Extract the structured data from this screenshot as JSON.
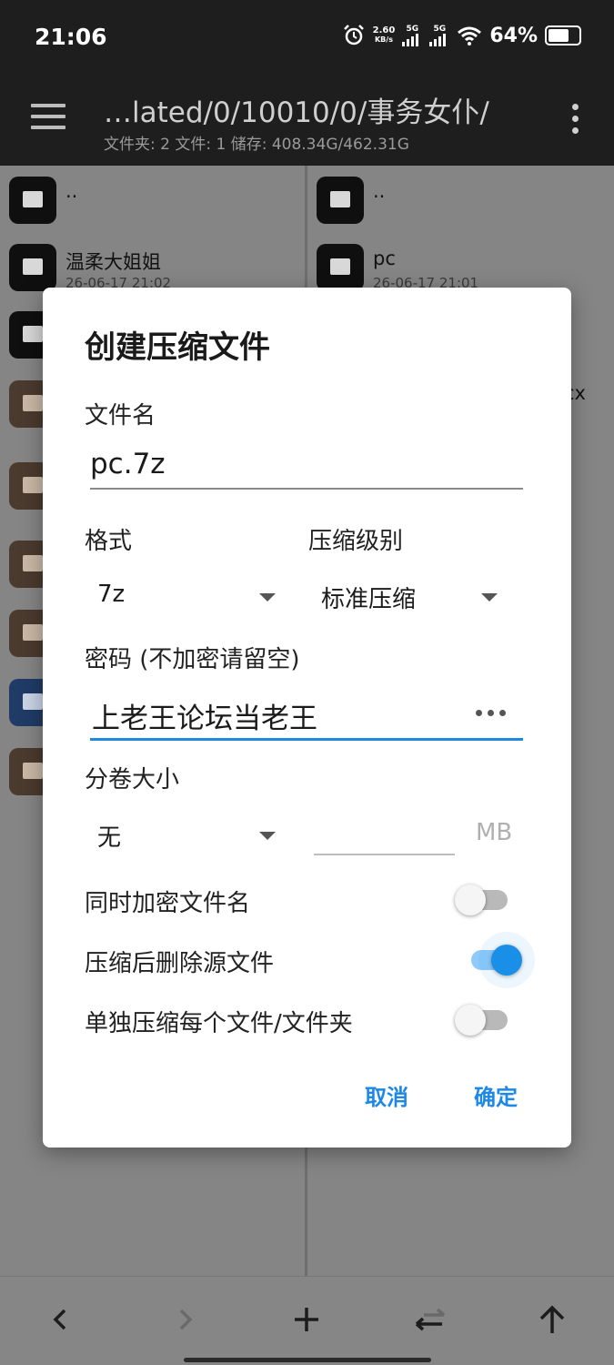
{
  "status_bar": {
    "time": "21:06",
    "net_speed_value": "2.60",
    "net_speed_unit": "KB/s",
    "sim1": "5G",
    "sim2": "5G",
    "battery": "64%"
  },
  "toolbar": {
    "path": "…lated/0/10010/0/事务女仆/",
    "summary": "文件夹: 2  文件: 1  储存: 408.34G/462.31G"
  },
  "left_pane": {
    "items": [
      {
        "name": "..",
        "date": "",
        "kind": "folder"
      },
      {
        "name": "温柔大姐姐",
        "date": "26-06-17 21:02",
        "kind": "folder"
      }
    ]
  },
  "right_pane": {
    "items": [
      {
        "name": "..",
        "date": "",
        "kind": "folder"
      },
      {
        "name": "pc",
        "date": "26-06-17 21:01",
        "kind": "folder"
      }
    ],
    "partial_text": "cx"
  },
  "dialog": {
    "title": "创建压缩文件",
    "filename_label": "文件名",
    "filename_value": "pc.7z",
    "format_label": "格式",
    "format_value": "7z",
    "level_label": "压缩级别",
    "level_value": "标准压缩",
    "password_label": "密码 (不加密请留空)",
    "password_value": "上老王论坛当老王",
    "split_label": "分卷大小",
    "split_value": "无",
    "split_unit": "MB",
    "split_size_value": "",
    "toggles": [
      {
        "label": "同时加密文件名",
        "on": false
      },
      {
        "label": "压缩后删除源文件",
        "on": true
      },
      {
        "label": "单独压缩每个文件/文件夹",
        "on": false
      }
    ],
    "cancel_label": "取消",
    "ok_label": "确定"
  },
  "bottom_bar": {
    "back_icon": "chevron-left",
    "forward_icon": "chevron-right",
    "add_icon": "plus",
    "swap_icon": "swap-arrows",
    "up_icon": "arrow-up"
  },
  "colors": {
    "accent": "#1e88e5",
    "toolbar_bg": "#1e1e1e",
    "switch_on": "#1a8fe8"
  }
}
